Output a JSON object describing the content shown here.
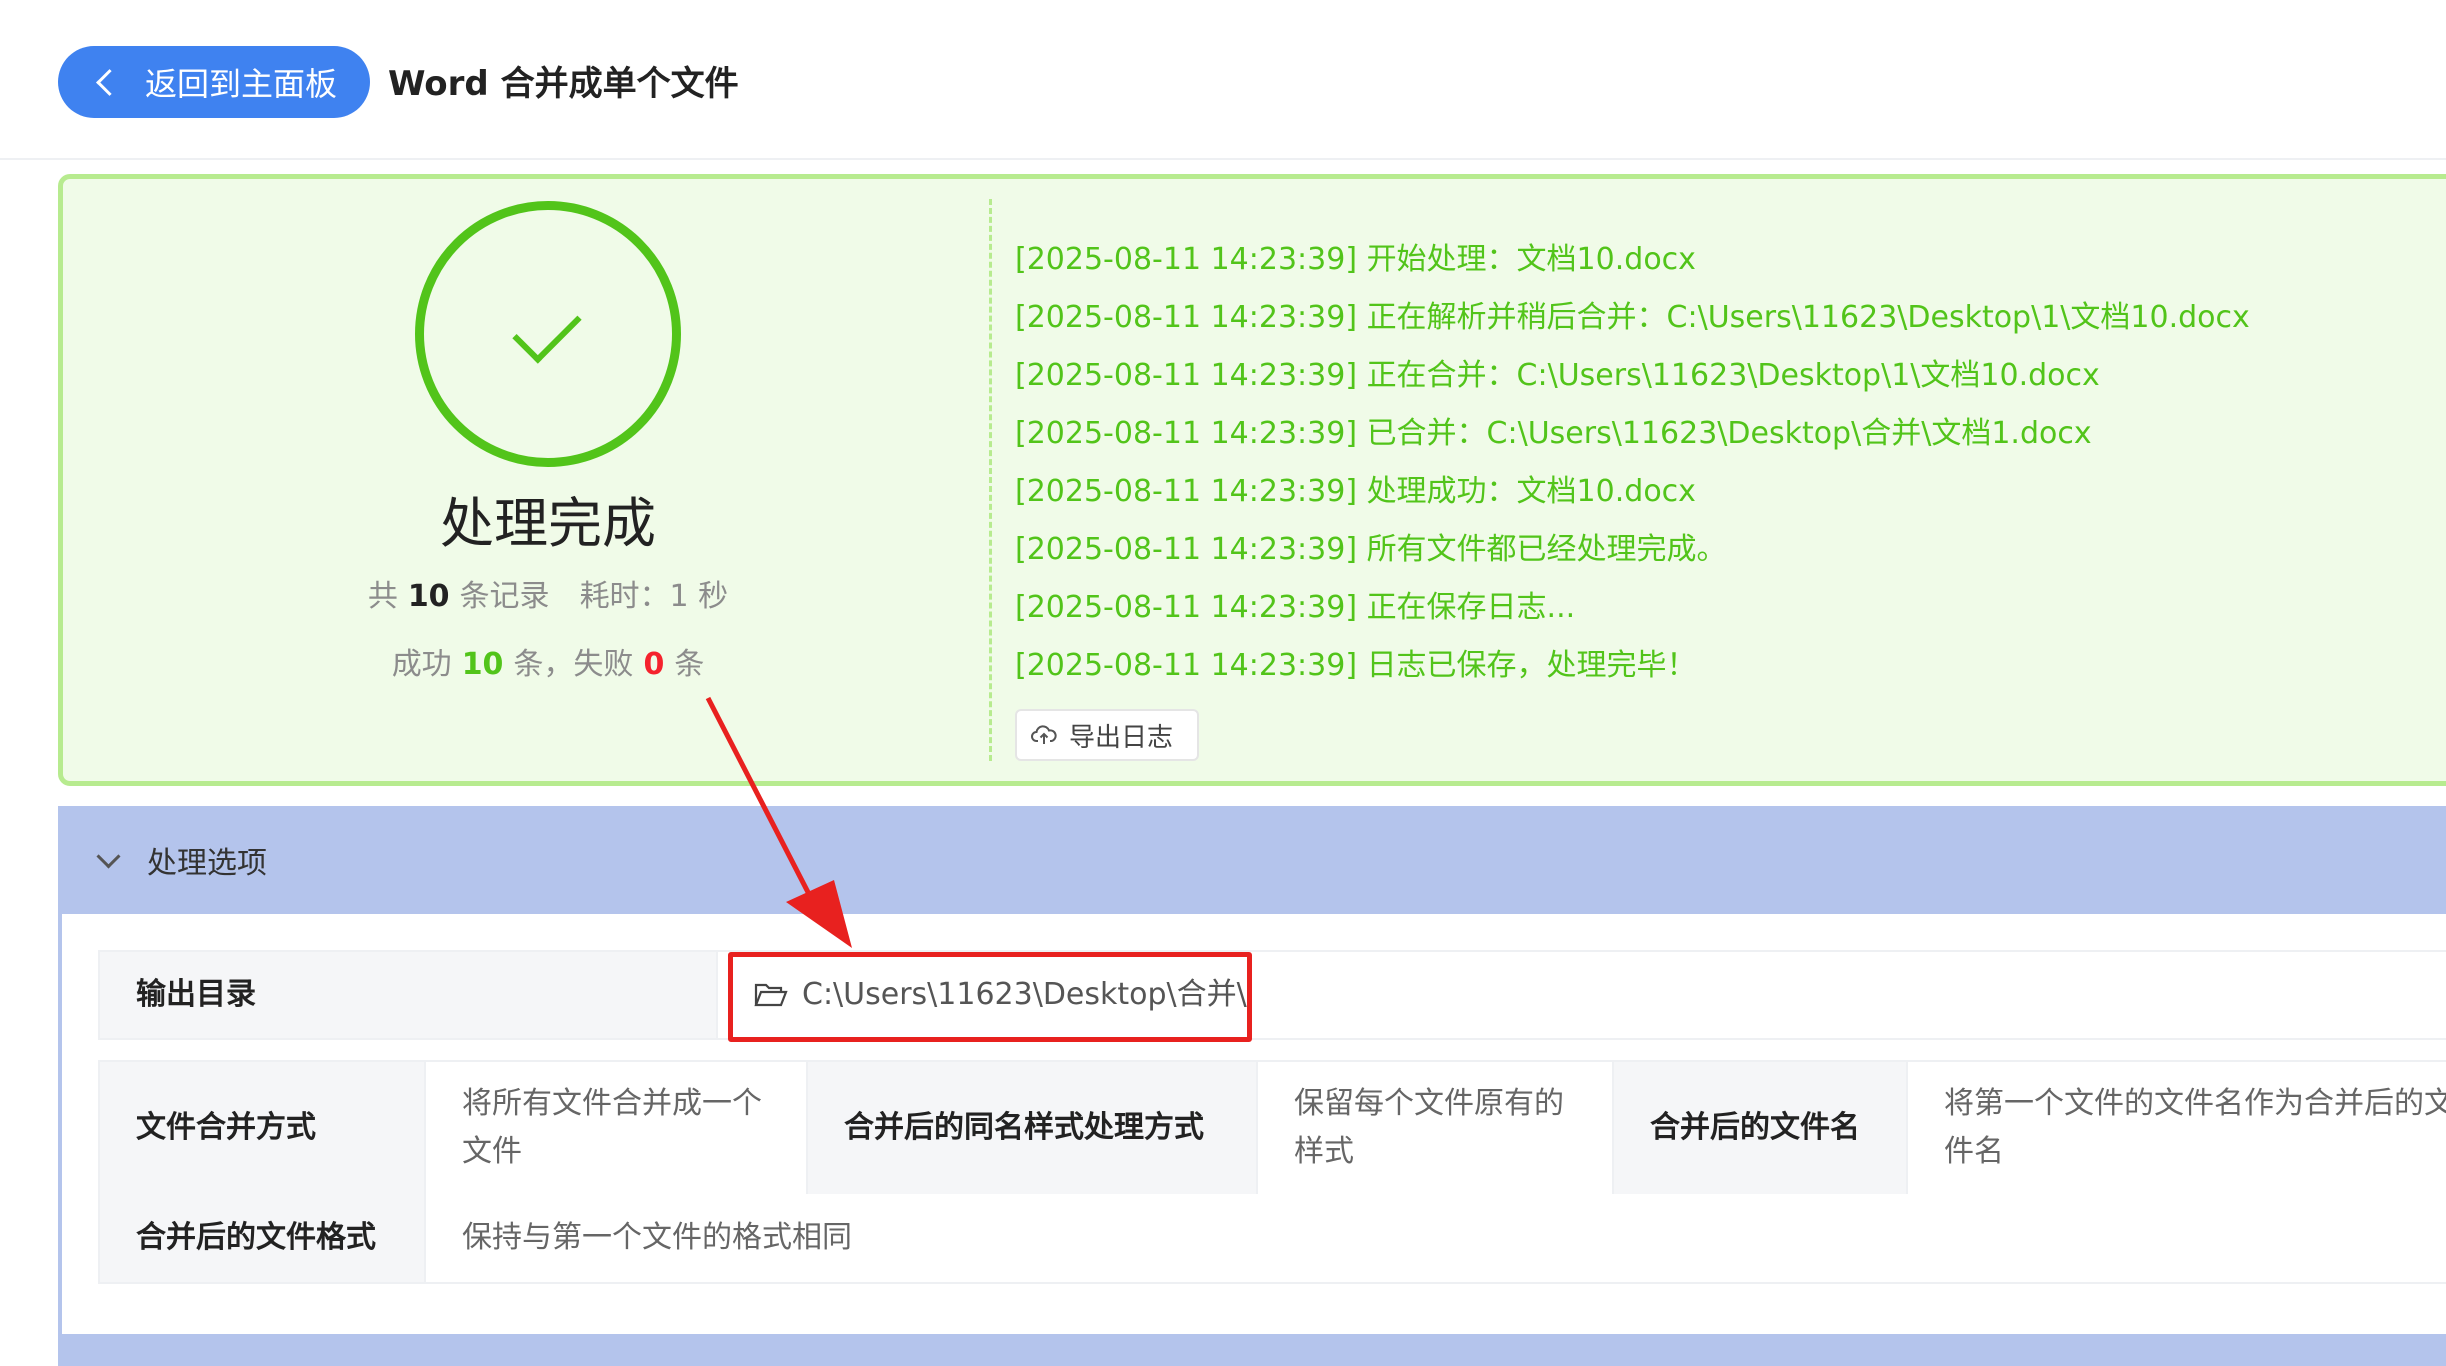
{
  "header": {
    "back_label": "返回到主面板",
    "title": "Word 合并成单个文件"
  },
  "result": {
    "status_title": "处理完成",
    "stats": {
      "total_prefix": "共",
      "total": "10",
      "total_suffix": "条记录",
      "time_label": "耗时：1 秒",
      "success_prefix": "成功",
      "success": "10",
      "success_suffix": "条，失败",
      "fail": "0",
      "fail_suffix": "条"
    },
    "logs": [
      "[2025-08-11 14:23:39] 开始处理：文档10.docx",
      "[2025-08-11 14:23:39] 正在解析并稍后合并：C:\\Users\\11623\\Desktop\\1\\文档10.docx",
      "[2025-08-11 14:23:39] 正在合并：C:\\Users\\11623\\Desktop\\1\\文档10.docx",
      "[2025-08-11 14:23:39] 已合并：C:\\Users\\11623\\Desktop\\合并\\文档1.docx",
      "[2025-08-11 14:23:39] 处理成功：文档10.docx",
      "[2025-08-11 14:23:39] 所有文件都已经处理完成。",
      "[2025-08-11 14:23:39] 正在保存日志...",
      "[2025-08-11 14:23:39] 日志已保存，处理完毕！"
    ],
    "export_label": "导出日志"
  },
  "options": {
    "section_title": "处理选项",
    "output_dir_label": "输出目录",
    "output_dir_value": "C:\\Users\\11623\\Desktop\\合并\\",
    "merge_mode_label": "文件合并方式",
    "merge_mode_value": "将所有文件合并成一个文件",
    "style_label": "合并后的同名样式处理方式",
    "style_value": "保留每个文件原有的样式",
    "filename_label": "合并后的文件名",
    "filename_value": "将第一个文件的文件名作为合并后的文件名",
    "format_label": "合并后的文件格式",
    "format_value": "保持与第一个文件的格式相同"
  },
  "colors": {
    "accent": "#3f82f0",
    "success": "#52c41a",
    "fail": "#f5222d",
    "annotation": "#e8211f"
  }
}
